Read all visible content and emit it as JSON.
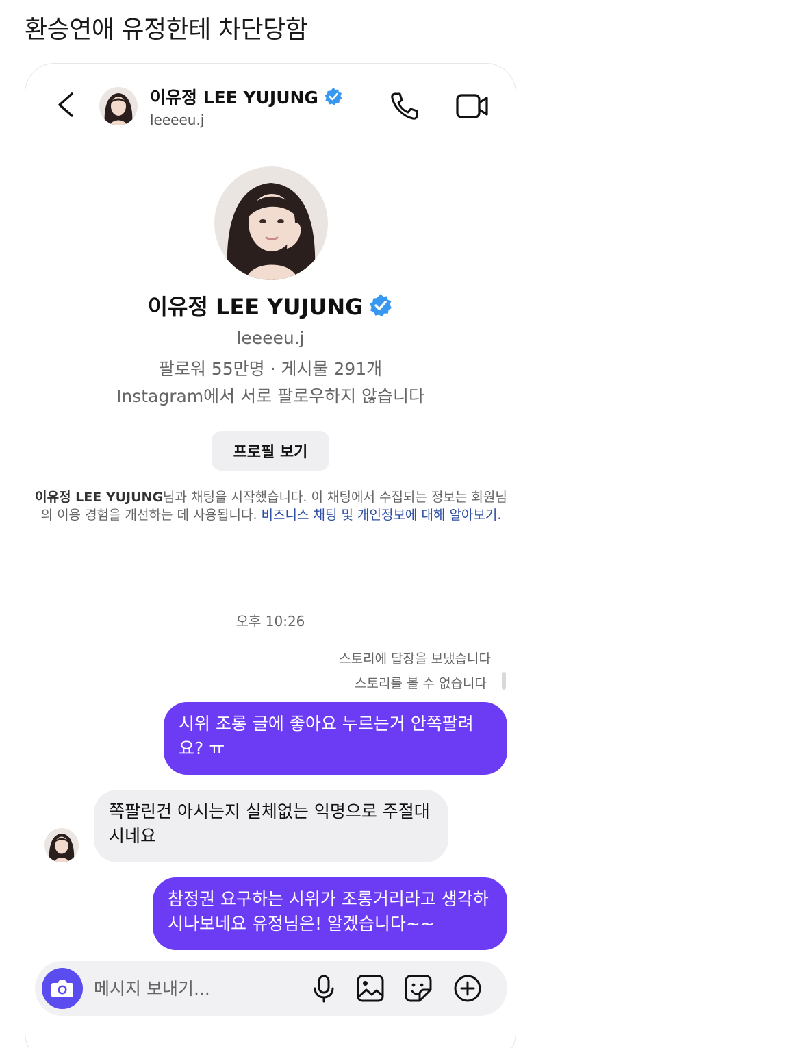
{
  "post": {
    "title": "환승연애 유정한테 차단당함"
  },
  "header": {
    "name": "이유정 LEE YUJUNG",
    "handle": "leeeeu.j",
    "icons": [
      "back-chevron-icon",
      "verified-badge-icon",
      "phone-call-icon",
      "video-call-icon"
    ]
  },
  "profile": {
    "name": "이유정 LEE YUJUNG",
    "handle": "leeeeu.j",
    "stats": "팔로워 55만명 · 게시물 291개",
    "mutual": "Instagram에서 서로 팔로우하지 않습니다",
    "view_button": "프로필 보기"
  },
  "notice": {
    "name": "이유정 LEE YUJUNG",
    "text": "님과 채팅을 시작했습니다. 이 채팅에서 수집되는 정보는 회원님의 이용 경험을 개선하는 데 사용됩니다. ",
    "link": "비즈니스 채팅 및 개인정보에 대해 알아보기."
  },
  "conversation": {
    "timestamp": "오후 10:26",
    "story_reply": "스토리에 답장을 보냈습니다",
    "story_unavailable": "스토리를 볼 수 없습니다",
    "messages": [
      {
        "from": "me",
        "text": "시위 조롱 글에 좋아요 누르는거 안쪽팔려요? ㅠ"
      },
      {
        "from": "them",
        "text": "쪽팔린건 아시는지 실체없는 익명으로 주절대시네요"
      },
      {
        "from": "me",
        "text": "참정권 요구하는 시위가 조롱거리라고 생각하시나보네요 유정님은! 알겠습니다~~"
      }
    ]
  },
  "composer": {
    "placeholder": "메시지 보내기...",
    "icons": [
      "camera-icon",
      "microphone-icon",
      "gallery-icon",
      "sticker-icon",
      "plus-circle-icon"
    ]
  },
  "colors": {
    "accent": "#6c3cf5",
    "camera": "#5b4cf0",
    "verified": "#3897f0",
    "link": "#2e4fa3"
  }
}
